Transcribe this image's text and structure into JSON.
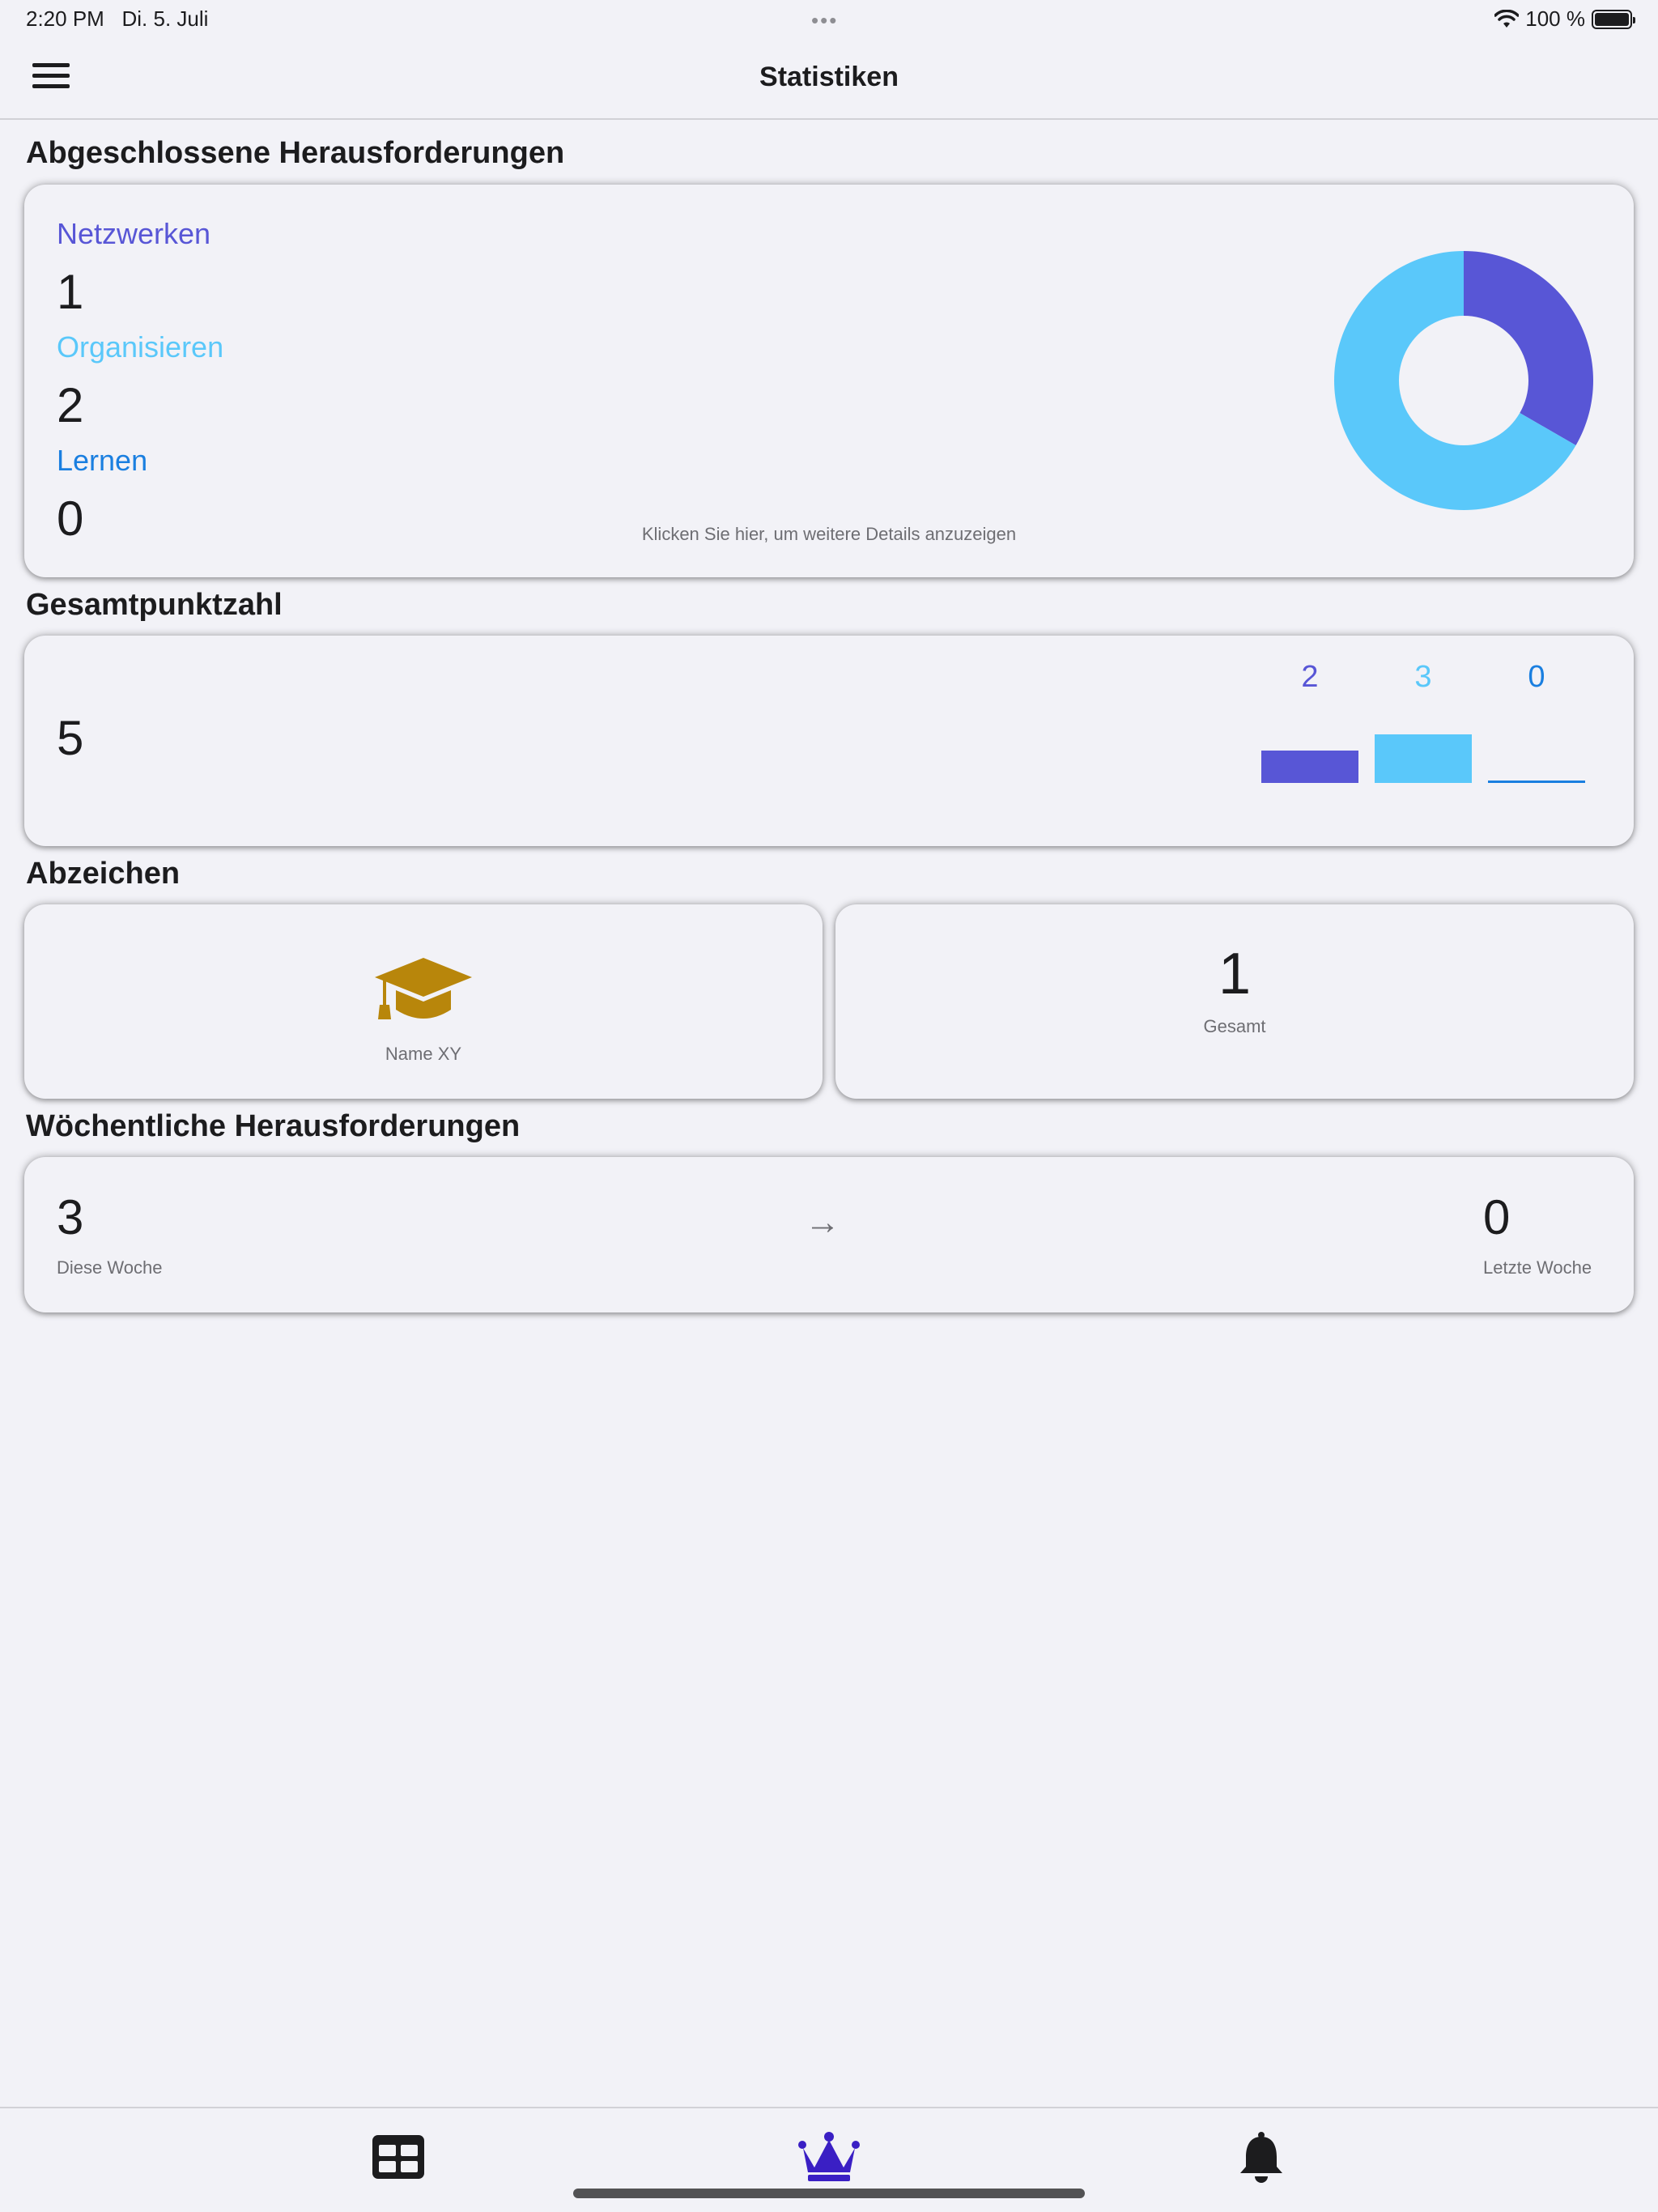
{
  "status_bar": {
    "time": "2:20 PM",
    "date": "Di. 5. Juli",
    "battery": "100 %"
  },
  "nav": {
    "title": "Statistiken",
    "menu_icon": "hamburger-menu-icon"
  },
  "completed": {
    "title": "Abgeschlossene Herausforderungen",
    "categories": [
      {
        "label": "Netzwerken",
        "value": "1",
        "color": "#5856d6"
      },
      {
        "label": "Organisieren",
        "value": "2",
        "color": "#5ac8fa"
      },
      {
        "label": "Lernen",
        "value": "0",
        "color": "#1a7fe0"
      }
    ],
    "hint": "Klicken Sie hier, um weitere Details anzuzeigen"
  },
  "chart_data": {
    "type": "pie",
    "categories": [
      "Netzwerken",
      "Organisieren",
      "Lernen"
    ],
    "values": [
      1,
      2,
      0
    ],
    "colors": [
      "#5856d6",
      "#5ac8fa",
      "#1a7fe0"
    ],
    "donut": true
  },
  "total": {
    "title": "Gesamtpunktzahl",
    "value": "5",
    "bars": [
      {
        "label": "2",
        "value": 2,
        "color": "#5856d6"
      },
      {
        "label": "3",
        "value": 3,
        "color": "#5ac8fa"
      },
      {
        "label": "0",
        "value": 0,
        "color": "#1a7fe0"
      }
    ]
  },
  "badges": {
    "title": "Abzeichen",
    "badge_name": "Name XY",
    "badge_icon": "graduation-cap-icon",
    "badge_color": "#b8860b",
    "count": "1",
    "count_label": "Gesamt"
  },
  "weekly": {
    "title": "Wöchentliche Herausforderungen",
    "this_week_value": "3",
    "this_week_label": "Diese Woche",
    "arrow": "→",
    "last_week_value": "0",
    "last_week_label": "Letzte Woche"
  },
  "tabs": [
    {
      "icon": "grid-table-icon",
      "active": false
    },
    {
      "icon": "crown-icon",
      "active": true,
      "color": "#3a1fc4"
    },
    {
      "icon": "bell-icon",
      "active": false
    }
  ]
}
